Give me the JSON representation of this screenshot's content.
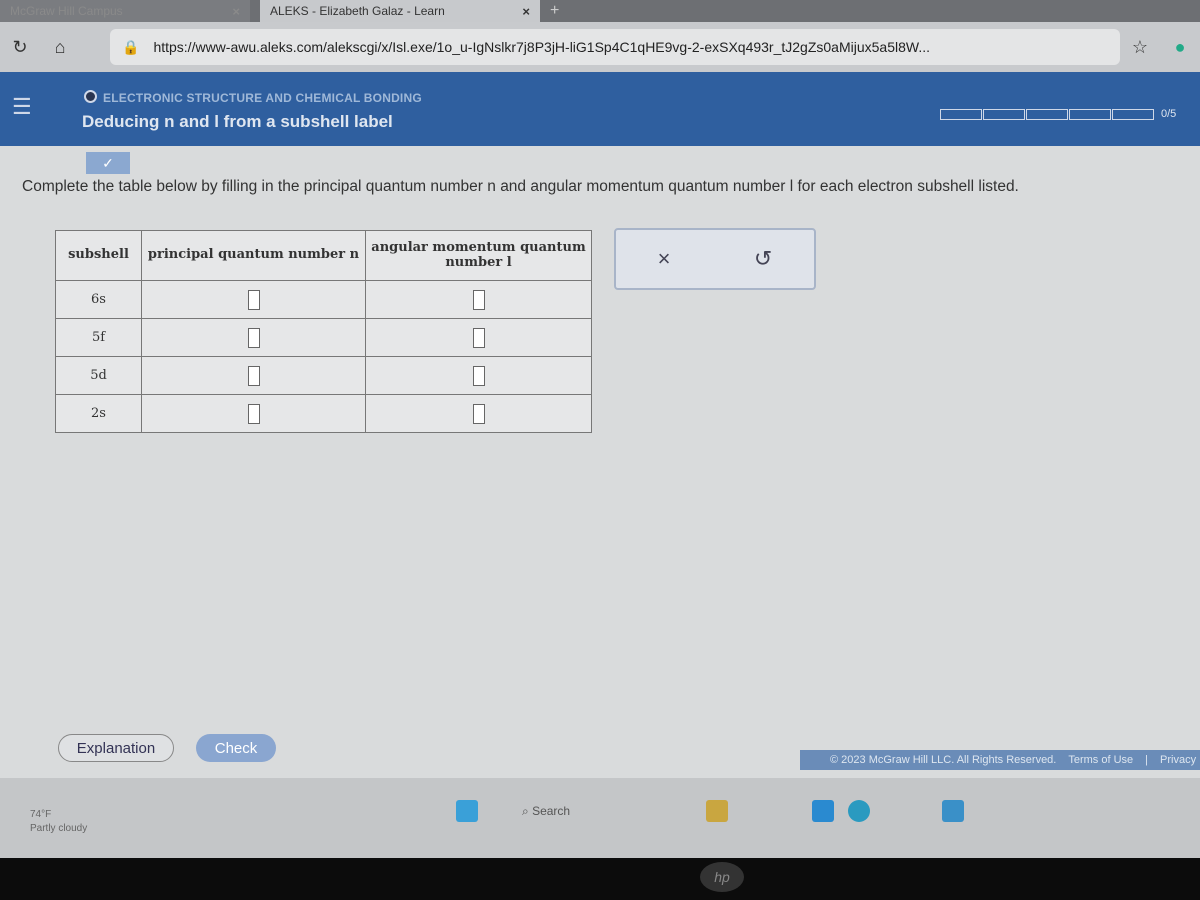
{
  "browser": {
    "tabs": [
      {
        "label": "McGraw Hill Campus",
        "close": "×"
      },
      {
        "label": "ALEKS - Elizabeth Galaz - Learn",
        "close": "×"
      }
    ],
    "new_tab": "+",
    "url": "https://www-awu.aleks.com/alekscgi/x/Isl.exe/1o_u-IgNslkr7j8P3jH-liG1Sp4C1qHE9vg-2-exSXq493r_tJ2gZs0aMijux5a5l8W..."
  },
  "header": {
    "topic": "ELECTRONIC STRUCTURE AND CHEMICAL BONDING",
    "title": "Deducing n and l from a subshell label",
    "progress": "0/5",
    "progress_fraction": 0
  },
  "instructions": "Complete the table below by filling in the principal quantum number n and angular momentum quantum number l for each electron subshell listed.",
  "table": {
    "headers": [
      "subshell",
      "principal quantum number n",
      "angular momentum quantum number l"
    ],
    "rows": [
      {
        "subshell": "6s",
        "n": "",
        "l": ""
      },
      {
        "subshell": "5f",
        "n": "",
        "l": ""
      },
      {
        "subshell": "5d",
        "n": "",
        "l": ""
      },
      {
        "subshell": "2s",
        "n": "",
        "l": ""
      }
    ]
  },
  "tools": {
    "clear": "×",
    "undo": "↺"
  },
  "buttons": {
    "explanation": "Explanation",
    "check": "Check"
  },
  "footer": {
    "copyright": "© 2023 McGraw Hill LLC. All Rights Reserved.",
    "terms": "Terms of Use",
    "privacy": "Privacy"
  },
  "taskbar": {
    "temp": "74°F",
    "weather": "Partly cloudy",
    "search": "Search"
  },
  "colors": {
    "header": "#2f5f9f",
    "check": "#8aa6d0"
  }
}
